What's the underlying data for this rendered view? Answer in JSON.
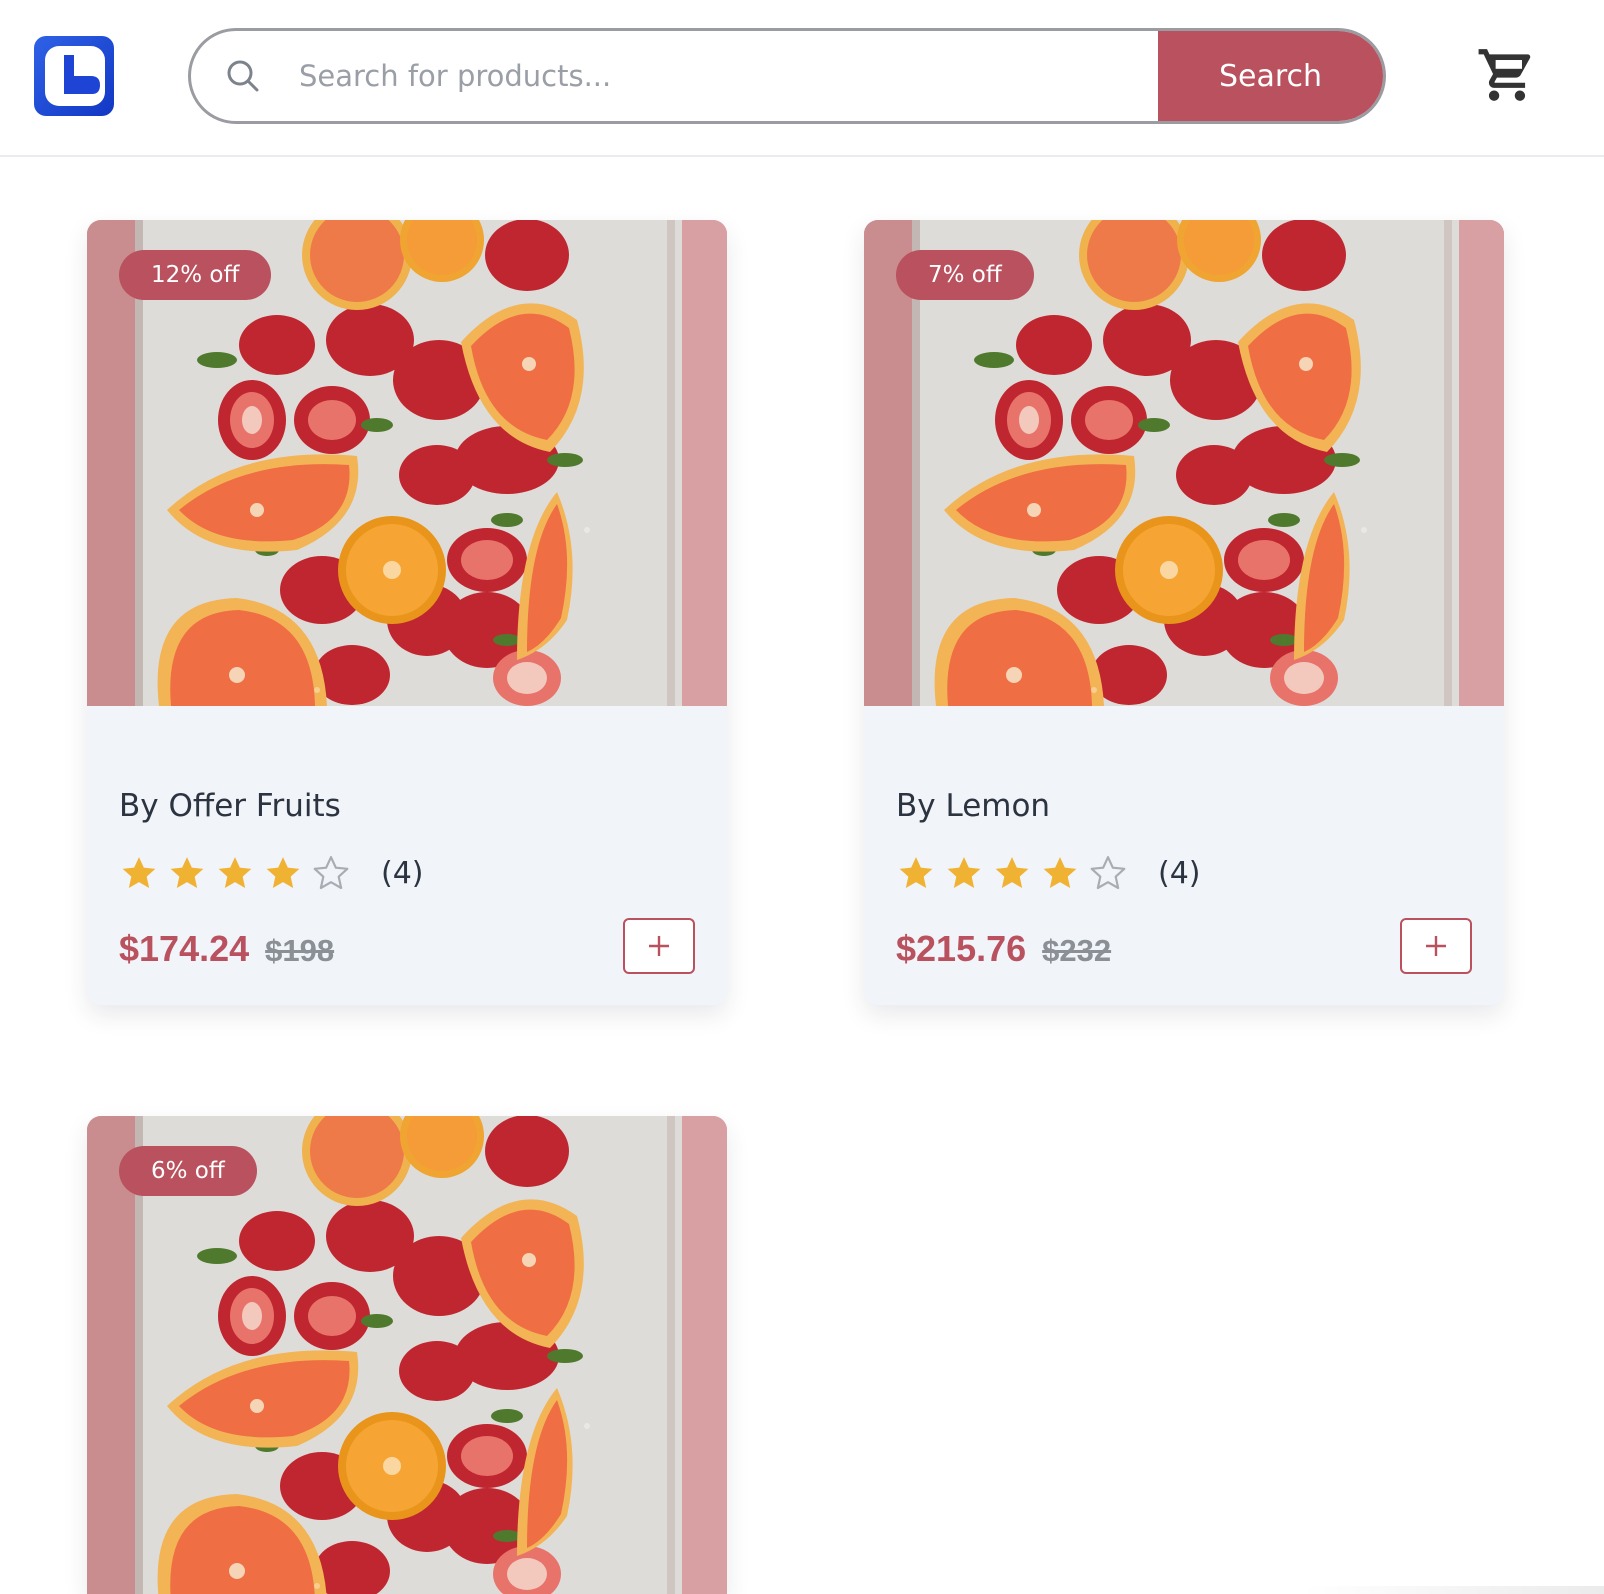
{
  "search": {
    "placeholder": "Search for products...",
    "button_label": "Search"
  },
  "icons": {
    "logo": "app-logo-icon",
    "search": "search-icon",
    "cart": "shopping-cart-icon",
    "star": "star-icon",
    "add": "plus-icon"
  },
  "colors": {
    "accent": "#b9515e",
    "star_filled": "#f0b232",
    "card_background": "#f1f4f8",
    "logo": "#1f4bd8"
  },
  "products": [
    {
      "discount": "12% off",
      "title": "By Offer Fruits",
      "rating": 4,
      "rating_max": 5,
      "rating_count": "(4)",
      "price": "$174.24",
      "original_price": "$198"
    },
    {
      "discount": "7% off",
      "title": "By Lemon",
      "rating": 4,
      "rating_max": 5,
      "rating_count": "(4)",
      "price": "$215.76",
      "original_price": "$232"
    },
    {
      "discount": "6% off"
    }
  ]
}
